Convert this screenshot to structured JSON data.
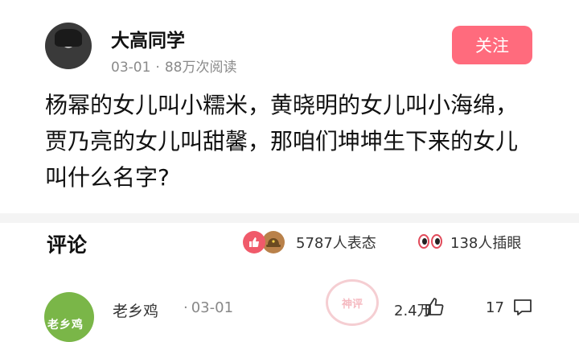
{
  "post": {
    "author": "大高同学",
    "date": "03-01",
    "separator": "·",
    "views": "88万次阅读",
    "follow_label": "关注",
    "text": "杨幂的女儿叫小糯米，黄晓明的女儿叫小海绵，贾乃亮的女儿叫甜馨，那咱们坤坤生下来的女儿叫什么名字?"
  },
  "comments_bar": {
    "title": "评论",
    "reactions": "5787人表态",
    "eyes": "138人插眼",
    "icons": [
      "like-reaction-icon",
      "hat-reaction-icon",
      "eyes-icon"
    ]
  },
  "comment": {
    "avatar_text": "老乡鸡",
    "name": "老乡鸡",
    "date": "03-01",
    "separator": "·",
    "stamp": "神评",
    "likes": "2.4万",
    "replies": "17",
    "icons": [
      "thumb-up-icon",
      "reply-icon"
    ]
  },
  "colors": {
    "follow_button": "#ff6b7d",
    "meta_text": "#8a8a8a",
    "divider": "#f4f4f4"
  }
}
